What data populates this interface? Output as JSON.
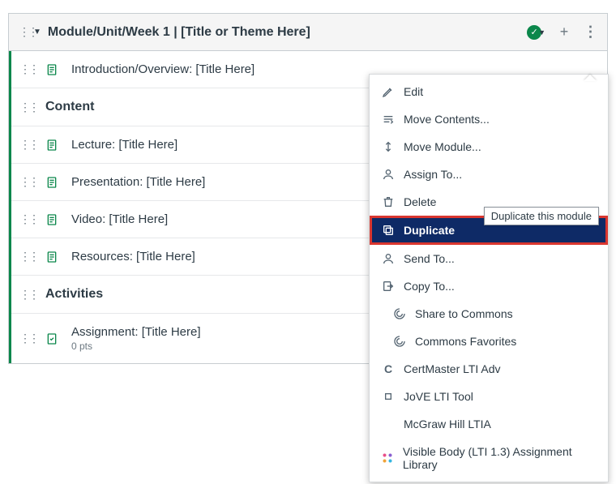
{
  "module": {
    "title": "Module/Unit/Week 1 | [Title or Theme Here]"
  },
  "items": [
    {
      "kind": "page",
      "title": "Introduction/Overview: [Title Here]"
    },
    {
      "kind": "subheader",
      "title": "Content"
    },
    {
      "kind": "page",
      "title": "Lecture: [Title Here]"
    },
    {
      "kind": "page",
      "title": "Presentation: [Title Here]"
    },
    {
      "kind": "page",
      "title": "Video: [Title Here]"
    },
    {
      "kind": "page",
      "title": "Resources: [Title Here]"
    },
    {
      "kind": "subheader",
      "title": "Activities"
    },
    {
      "kind": "assignment",
      "title": "Assignment: [Title Here]",
      "subtitle": "0 pts"
    }
  ],
  "menu": {
    "edit": "Edit",
    "move_contents": "Move Contents...",
    "move_module": "Move Module...",
    "assign_to": "Assign To...",
    "delete": "Delete",
    "duplicate": "Duplicate",
    "send_to": "Send To...",
    "copy_to": "Copy To...",
    "share_commons": "Share to Commons",
    "commons_fav": "Commons Favorites",
    "certmaster": "CertMaster LTI Adv",
    "jove": "JoVE LTI Tool",
    "mcgraw": "McGraw Hill LTIA",
    "visible_body": "Visible Body (LTI 1.3) Assignment Library"
  },
  "tooltip": "Duplicate this module"
}
